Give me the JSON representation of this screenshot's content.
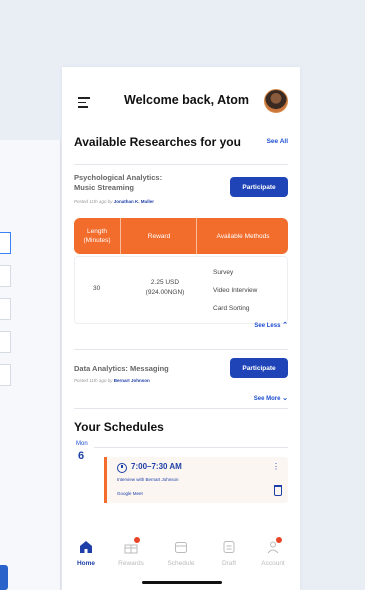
{
  "header": {
    "welcome": "Welcome back, Atom"
  },
  "researches": {
    "title": "Available Researches for you",
    "see_all": "See All",
    "items": [
      {
        "title": "Psychological Analytics: Music Streaming",
        "posted_prefix": "Posted 11th ago by",
        "author": "Jonathan K. Muller",
        "participate": "Participate"
      },
      {
        "title": "Data Analytics: Messaging",
        "posted_prefix": "Posted 11th ago by",
        "author": "Bernart Johnson",
        "participate": "Participate"
      }
    ],
    "table": {
      "headers": [
        "Length (Minutes)",
        "Reward",
        "Available Methods"
      ],
      "length": "30",
      "reward_line1": "2.25 USD",
      "reward_line2": "(924.00NGN)",
      "methods": [
        "Survey",
        "Video Interview",
        "Card Sorting"
      ]
    },
    "see_less": "See Less",
    "see_more": "See More"
  },
  "schedules": {
    "title": "Your Schedules",
    "day_name": "Mon",
    "day_num": "6",
    "event": {
      "time": "7:00–7:30 AM",
      "desc": "Interview with Bernart Johnson",
      "platform": "Google Meet"
    }
  },
  "nav": {
    "items": [
      {
        "label": "Home",
        "icon": "home-icon",
        "active": true
      },
      {
        "label": "Rewards",
        "icon": "gift-icon",
        "badge": true
      },
      {
        "label": "Schedule",
        "icon": "calendar-icon"
      },
      {
        "label": "Draft",
        "icon": "draft-icon"
      },
      {
        "label": "Account",
        "icon": "user-icon",
        "badge": true
      }
    ]
  },
  "colors": {
    "accent": "#f26c2c",
    "primary": "#1f44b8",
    "link": "#1e4fd1"
  }
}
